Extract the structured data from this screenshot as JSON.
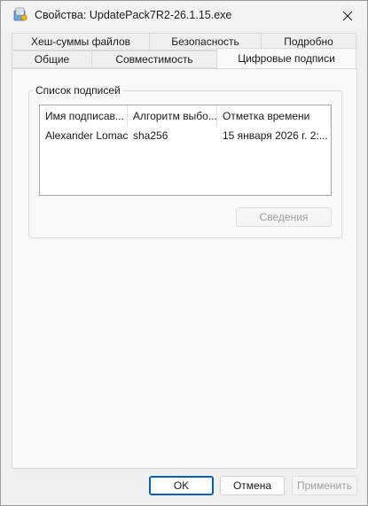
{
  "window": {
    "title": "Свойства: UpdatePack7R2-26.1.15.exe",
    "close_icon": "close-icon",
    "app_icon": "installer-icon"
  },
  "tabs": {
    "row_back": [
      {
        "label": "Хеш-суммы файлов"
      },
      {
        "label": "Безопасность"
      },
      {
        "label": "Подробно"
      }
    ],
    "row_front": [
      {
        "label": "Общие"
      },
      {
        "label": "Совместимость"
      },
      {
        "label": "Цифровые подписи"
      }
    ],
    "selected": "Цифровые подписи"
  },
  "signatures": {
    "group_label": "Список подписей",
    "columns": [
      {
        "label": "Имя подписав..."
      },
      {
        "label": "Алгоритм выбо..."
      },
      {
        "label": "Отметка времени"
      }
    ],
    "rows": [
      {
        "signer": "Alexander Lomac...",
        "algorithm": "sha256",
        "timestamp": "15 января 2026 г. 2:..."
      }
    ],
    "details_label": "Сведения"
  },
  "footer": {
    "ok_label": "OK",
    "cancel_label": "Отмена",
    "apply_label": "Применить"
  },
  "colors": {
    "accent": "#005fb8",
    "panel": "#f9f9f9",
    "window": "#f0f0f0"
  }
}
